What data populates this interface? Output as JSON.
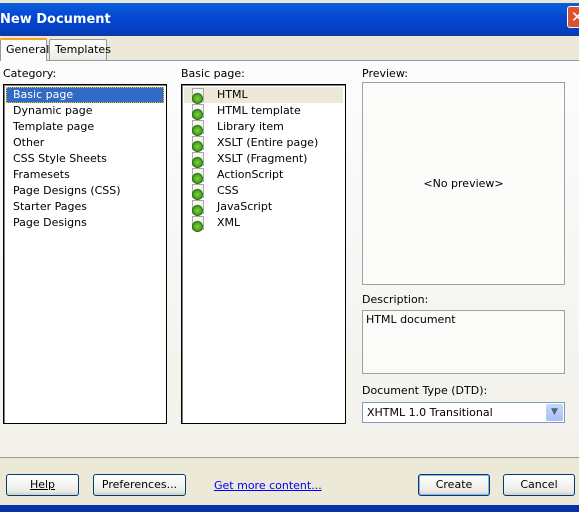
{
  "window": {
    "title": "New Document",
    "close_icon": "close-icon"
  },
  "tabs": [
    {
      "label": "General",
      "active": true
    },
    {
      "label": "Templates",
      "active": false
    }
  ],
  "category": {
    "label": "Category:",
    "items": [
      "Basic page",
      "Dynamic page",
      "Template page",
      "Other",
      "CSS Style Sheets",
      "Framesets",
      "Page Designs (CSS)",
      "Starter Pages",
      "Page Designs"
    ],
    "selected": "Basic page"
  },
  "basic_page": {
    "label": "Basic page:",
    "items": [
      "HTML",
      "HTML template",
      "Library item",
      "XSLT (Entire page)",
      "XSLT (Fragment)",
      "ActionScript",
      "CSS",
      "JavaScript",
      "XML"
    ],
    "selected": "HTML",
    "icon": "dreamweaver-file-icon"
  },
  "preview": {
    "label": "Preview:",
    "text": "<No preview>"
  },
  "description": {
    "label": "Description:",
    "text": "HTML document"
  },
  "doctype": {
    "label": "Document Type (DTD):",
    "value": "XHTML 1.0 Transitional"
  },
  "buttons": {
    "help": "Help",
    "preferences": "Preferences...",
    "get_more": "Get more content...",
    "create": "Create",
    "cancel": "Cancel"
  },
  "colors": {
    "titlebar": "#0548d0",
    "selection": "#316ac5",
    "link": "#0000ff"
  }
}
